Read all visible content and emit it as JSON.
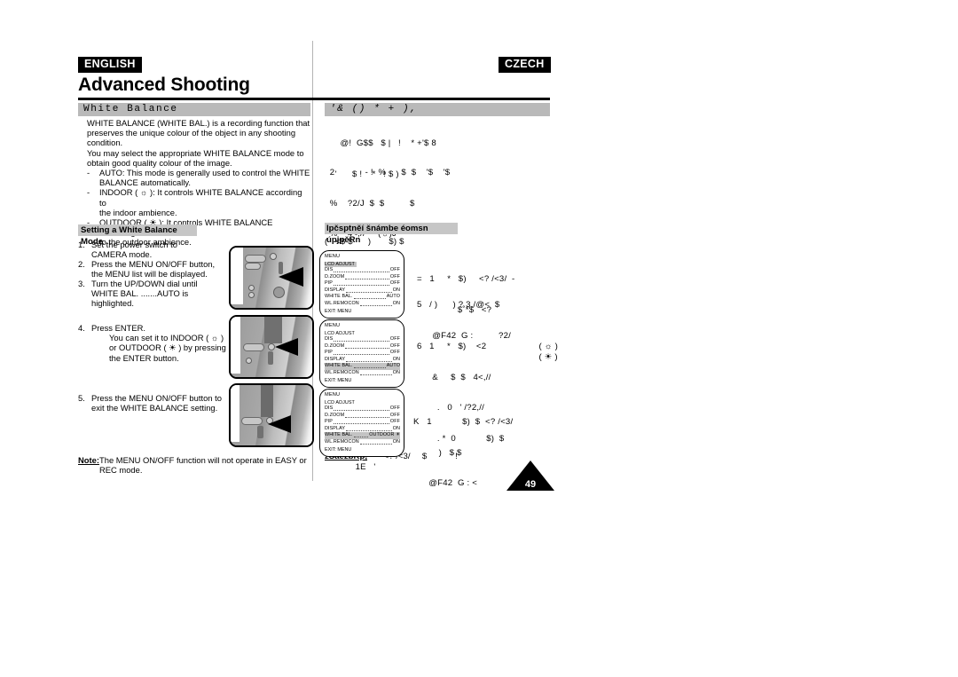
{
  "header": {
    "english_badge": "ENGLISH",
    "czech_badge": "CZECH",
    "page_title": "Advanced Shooting"
  },
  "english": {
    "section_heading": "White Balance",
    "intro": [
      "WHITE BALANCE (WHITE BAL.) is a recording function that",
      "preserves the unique colour of the object in any shooting",
      "condition.",
      "You may select the appropriate WHITE BALANCE mode to",
      "obtain good quality colour of the image."
    ],
    "bullets": [
      {
        "dash": "-",
        "lines": [
          "AUTO: This mode is generally used to control the WHITE",
          "BALANCE automatically."
        ]
      },
      {
        "dash": "-",
        "lines": [
          "INDOOR ( ☼ ): It controls WHITE BALANCE according to",
          "the indoor ambience."
        ]
      },
      {
        "dash": "-",
        "lines": [
          "OUTDOOR ( ☀ ): It controls WHITE BALANCE according",
          "to the outdoor ambience."
        ]
      }
    ],
    "sub_heading": "Setting a White Balance Mode",
    "steps": [
      {
        "num": "1.",
        "lines": [
          "Set the power switch to",
          "CAMERA mode."
        ],
        "sub": []
      },
      {
        "num": "2.",
        "lines": [
          "Press the MENU ON/OFF button,",
          "the MENU list will be displayed."
        ],
        "sub": []
      },
      {
        "num": "3.",
        "lines": [
          "Turn the UP/DOWN dial until",
          "WHITE BAL. .......AUTO is highlighted."
        ],
        "sub": []
      },
      {
        "num": "4.",
        "lines": [
          "Press ENTER."
        ],
        "sub": [
          "You can set it to INDOOR ( ☼ )",
          "or OUTDOOR ( ☀ ) by pressing",
          "the ENTER button."
        ]
      },
      {
        "num": "5.",
        "lines": [
          "Press the MENU ON/OFF button to",
          "exit the WHITE BALANCE setting."
        ],
        "sub": []
      }
    ],
    "note_label": "Note:",
    "note_text": [
      "The MENU ON/OFF function will not operate in EASY or",
      "REC mode."
    ]
  },
  "czech": {
    "section_heading": "'&  ()     * +     ),",
    "intro": [
      "    @!  G$$   $ |   !    * +'$ 8",
      "  '      $ !    *   ! $ )"
    ],
    "body": [
      "  2            - !  %      $  $    '$    '$",
      "  %    ?2/J  $  $          $",
      "  %    4<,//     (☼)J",
      "  %    /?2,//      (☀)J"
    ],
    "sub_heading": "lpčsptněí šnámbe éomsn úpjpěRn",
    "sub_line": "(   <$ $      )       $) $",
    "step_blocks": [
      {
        "lines": [
          "=   1     *   $)     <? /<3/  -",
          "                $˚*$   <?"
        ]
      },
      {
        "lines": [
          "5   / )      ) ? 3,/@<  $",
          "      @F42  G :          ?2/"
        ]
      },
      {
        "lines": [
          "6   1     *   $)    <2",
          "      &     $  $   4<,//",
          "        .   0   ' /?2,//",
          "        . *  0            $)  $"
        ]
      },
      {
        "lines": [
          "K   1            $)  $  <? /<3/",
          "          )   $ $",
          "      @F42  G : <"
        ]
      }
    ],
    "icons_inline": [
      "( ☼ )",
      "( ☀ )"
    ],
    "note_label": "žSaězbKp,",
    "note_text": "       <? /<3/     $            !",
    "note_text2": "   1E   '"
  },
  "menus": [
    {
      "title": "MENU",
      "highlight": "LCD ADJUST",
      "rows": [
        {
          "label": "DIS",
          "value": "OFF"
        },
        {
          "label": "D.ZOOM",
          "value": "OFF"
        },
        {
          "label": "PIP",
          "value": "OFF"
        },
        {
          "label": "DISPLAY",
          "value": "ON"
        },
        {
          "label": "WHITE BAL.",
          "value": "AUTO"
        },
        {
          "label": "WL.REMOCON",
          "value": "ON"
        }
      ],
      "exit": "EXIT: MENU",
      "highlight_row": "LCD ADJUST"
    },
    {
      "title": "MENU",
      "highlight": "WHITE BAL.",
      "rows": [
        {
          "label": "DIS",
          "value": "OFF"
        },
        {
          "label": "D.ZOOM",
          "value": "OFF"
        },
        {
          "label": "PIP",
          "value": "OFF"
        },
        {
          "label": "DISPLAY",
          "value": "ON"
        },
        {
          "label": "WHITE BAL.",
          "value": "AUTO"
        },
        {
          "label": "WL.REMOCON",
          "value": "ON"
        }
      ],
      "exit": "EXIT: MENU",
      "lcd_label": "LCD ADJUST",
      "highlight_row": "WHITE BAL."
    },
    {
      "title": "MENU",
      "highlight": "WHITE BAL.",
      "rows": [
        {
          "label": "DIS",
          "value": "OFF"
        },
        {
          "label": "D.ZOOM",
          "value": "OFF"
        },
        {
          "label": "PIP",
          "value": "OFF"
        },
        {
          "label": "DISPLAY",
          "value": "ON"
        },
        {
          "label": "WHITE BAL.",
          "value": "OUTDOOR ☀"
        },
        {
          "label": "WL.REMOCON",
          "value": "ON"
        }
      ],
      "exit": "EXIT: MENU",
      "lcd_label": "LCD ADJUST",
      "highlight_row": "WHITE BAL."
    }
  ],
  "page_number": "49",
  "colors": {
    "section_bar": "#b9b9b9",
    "badge_bg": "#000000",
    "highlight": "#c3c3c3"
  }
}
